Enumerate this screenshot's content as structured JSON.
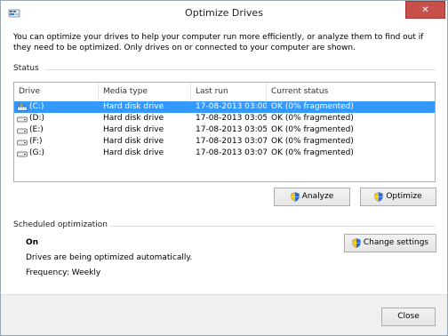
{
  "window": {
    "title": "Optimize Drives",
    "close_glyph": "✕"
  },
  "intro": "You can optimize your drives to help your computer run more efficiently, or analyze them to find out if they need to be optimized. Only drives on or connected to your computer are shown.",
  "status": {
    "section_label": "Status",
    "columns": [
      "Drive",
      "Media type",
      "Last run",
      "Current status"
    ],
    "drives": [
      {
        "drive": "(C:)",
        "media": "Hard disk drive",
        "last_run": "17-08-2013 03:00 P...",
        "status": "OK (0% fragmented)",
        "selected": true,
        "icon": "system-drive-icon"
      },
      {
        "drive": "(D:)",
        "media": "Hard disk drive",
        "last_run": "17-08-2013 03:05 P...",
        "status": "OK (0% fragmented)",
        "selected": false,
        "icon": "hard-drive-icon"
      },
      {
        "drive": "(E:)",
        "media": "Hard disk drive",
        "last_run": "17-08-2013 03:05 P...",
        "status": "OK (0% fragmented)",
        "selected": false,
        "icon": "hard-drive-icon"
      },
      {
        "drive": "(F:)",
        "media": "Hard disk drive",
        "last_run": "17-08-2013 03:07 P...",
        "status": "OK (0% fragmented)",
        "selected": false,
        "icon": "hard-drive-icon"
      },
      {
        "drive": "(G:)",
        "media": "Hard disk drive",
        "last_run": "17-08-2013 03:07 P...",
        "status": "OK (0% fragmented)",
        "selected": false,
        "icon": "hard-drive-icon"
      }
    ],
    "analyze_label": "Analyze",
    "optimize_label": "Optimize"
  },
  "scheduled": {
    "section_label": "Scheduled optimization",
    "state": "On",
    "description": "Drives are being optimized automatically.",
    "frequency": "Frequency: Weekly",
    "change_settings_label": "Change settings"
  },
  "footer": {
    "close_label": "Close"
  },
  "colors": {
    "selection": "#3399ff",
    "close_button": "#c7504b"
  }
}
